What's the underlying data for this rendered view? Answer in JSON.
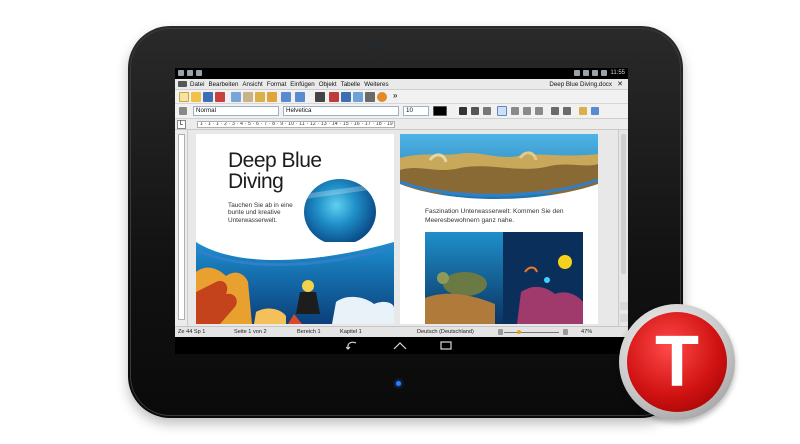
{
  "statusbar": {
    "time": "11:55"
  },
  "menu": {
    "items": [
      "Datei",
      "Bearbeiten",
      "Ansicht",
      "Format",
      "Einfügen",
      "Objekt",
      "Tabelle",
      "Weiteres"
    ],
    "document_title": "Deep Blue Diving.docx",
    "close_glyph": "✕"
  },
  "format": {
    "style": "Normal",
    "font": "Helvetica",
    "size": "10",
    "more_glyph": "»"
  },
  "ruler": {
    "corner_glyph": "L",
    "scale": "1 · 1 · 1 · 2 · 3 · 4 · 5 · 6 · 7 · 8 · 9 · 10 · 11 · 12 · 13 · 14 · 15 · 16 · 17 · 18 · 19"
  },
  "document": {
    "page1": {
      "title_line1": "Deep Blue",
      "title_line2": "Diving",
      "body": "Tauchen Sie ab in eine bunte und kreative Unterwasserwelt."
    },
    "page2": {
      "body": "Faszination Unterwasserwelt: Kommen Sie den Meeresbewohnern ganz nahe."
    }
  },
  "statusline": {
    "position": "Ze 44 Sp 1",
    "page": "Seite 1 von 2",
    "area": "Bereich 1",
    "chapter": "Kapitel 1",
    "language": "Deutsch (Deutschland)",
    "zoom": "47%"
  },
  "navbar": {
    "back_icon": "back-icon",
    "home_icon": "home-icon",
    "recents_icon": "recents-icon"
  },
  "brand": {
    "letter": "T",
    "colors": {
      "red": "#d11212",
      "silver": "#c9c9c9"
    }
  },
  "colors": {
    "ocean_blue": "#0b6fb3",
    "highlight_blue": "#2a7dff"
  }
}
